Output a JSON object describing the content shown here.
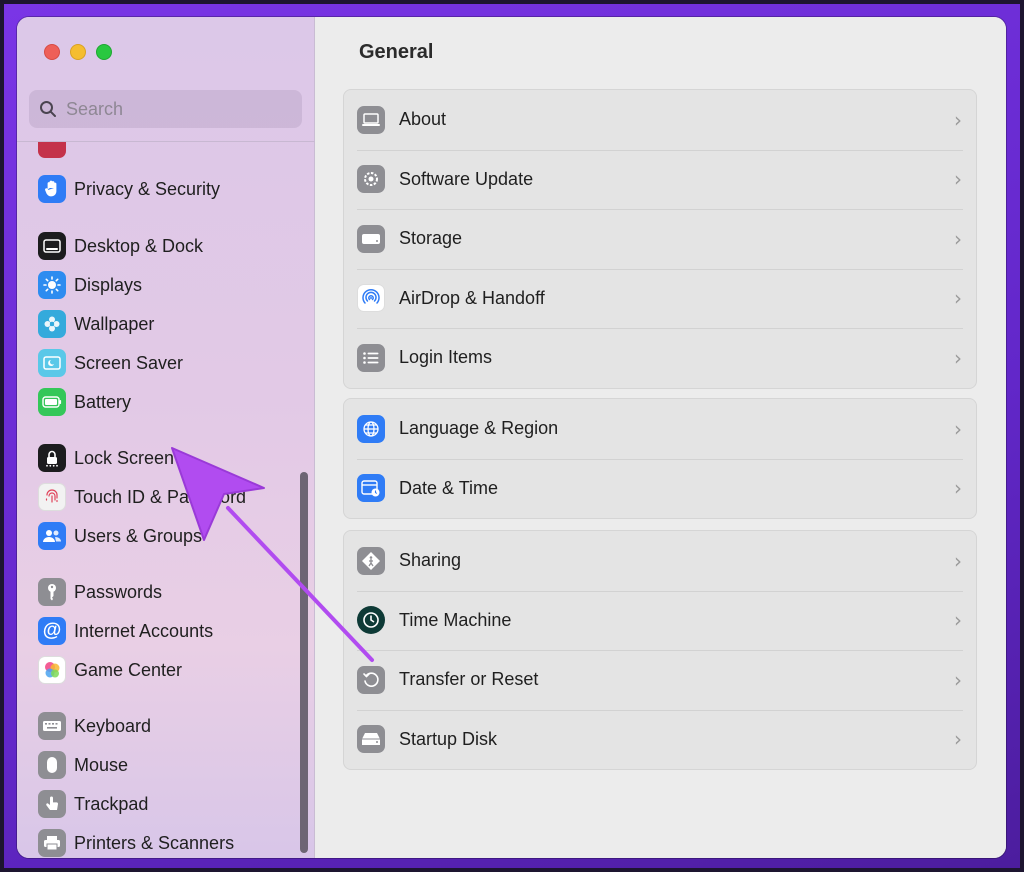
{
  "window": {
    "title": "General"
  },
  "search": {
    "placeholder": "Search"
  },
  "sidebar": {
    "items": [
      {
        "label": "Privacy & Security",
        "icon": "hand-icon",
        "color": "#2f7cf6"
      },
      {
        "label": "Desktop & Dock",
        "icon": "dock-icon",
        "color": "#1c1c1e"
      },
      {
        "label": "Displays",
        "icon": "sun-icon",
        "color": "#2d8cf0"
      },
      {
        "label": "Wallpaper",
        "icon": "flower-icon",
        "color": "#34aadc"
      },
      {
        "label": "Screen Saver",
        "icon": "screensaver-icon",
        "color": "#5ac8e8"
      },
      {
        "label": "Battery",
        "icon": "battery-icon",
        "color": "#34c759"
      },
      {
        "label": "Lock Screen",
        "icon": "lock-icon",
        "color": "#1c1c1e"
      },
      {
        "label": "Touch ID & Password",
        "icon": "fingerprint-icon",
        "color": "#f2f2f2"
      },
      {
        "label": "Users & Groups",
        "icon": "users-icon",
        "color": "#2f7cf6"
      },
      {
        "label": "Passwords",
        "icon": "key-icon",
        "color": "#8e8e93"
      },
      {
        "label": "Internet Accounts",
        "icon": "at-icon",
        "color": "#2f7cf6"
      },
      {
        "label": "Game Center",
        "icon": "gamecenter-icon",
        "color": "#ffffff"
      },
      {
        "label": "Keyboard",
        "icon": "keyboard-icon",
        "color": "#8e8e93"
      },
      {
        "label": "Mouse",
        "icon": "mouse-icon",
        "color": "#8e8e93"
      },
      {
        "label": "Trackpad",
        "icon": "trackpad-icon",
        "color": "#8e8e93"
      },
      {
        "label": "Printers & Scanners",
        "icon": "printer-icon",
        "color": "#8e8e93"
      }
    ]
  },
  "groups": [
    {
      "rows": [
        {
          "label": "About",
          "icon": "laptop-icon"
        },
        {
          "label": "Software Update",
          "icon": "gear-badge-icon"
        },
        {
          "label": "Storage",
          "icon": "drive-icon"
        },
        {
          "label": "AirDrop & Handoff",
          "icon": "airdrop-icon"
        },
        {
          "label": "Login Items",
          "icon": "list-icon"
        }
      ]
    },
    {
      "rows": [
        {
          "label": "Language & Region",
          "icon": "globe-icon"
        },
        {
          "label": "Date & Time",
          "icon": "calendar-clock-icon"
        }
      ]
    },
    {
      "rows": [
        {
          "label": "Sharing",
          "icon": "sharing-icon"
        },
        {
          "label": "Time Machine",
          "icon": "time-machine-icon"
        },
        {
          "label": "Transfer or Reset",
          "icon": "reset-icon"
        },
        {
          "label": "Startup Disk",
          "icon": "disk-icon"
        }
      ]
    }
  ],
  "chevron": "›",
  "annotation": {
    "color": "#b14cf0"
  }
}
